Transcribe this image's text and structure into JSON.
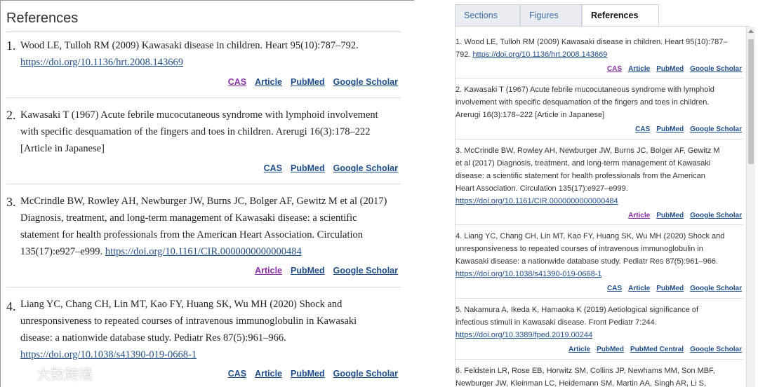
{
  "left": {
    "title": "References",
    "refs": [
      {
        "num": "1.",
        "lines": [
          "Wood LE, Tulloh RM (2009) Kawasaki disease in children. Heart 95(10):787–792."
        ],
        "doi": "https://doi.org/10.1136/hrt.2008.143669",
        "links": [
          {
            "label": "CAS",
            "visited": true
          },
          {
            "label": "Article"
          },
          {
            "label": "PubMed"
          },
          {
            "label": "Google Scholar"
          }
        ]
      },
      {
        "num": "2.",
        "lines": [
          "Kawasaki T (1967) Acute febrile mucocutaneous syndrome with lymphoid involvement",
          "with specific desquamation of the fingers and toes in children. Arerugi 16(3):178–222",
          "[Article in Japanese]"
        ],
        "links": [
          {
            "label": "CAS"
          },
          {
            "label": "PubMed"
          },
          {
            "label": "Google Scholar"
          }
        ]
      },
      {
        "num": "3.",
        "lines": [
          "McCrindle BW, Rowley AH, Newburger JW, Burns JC, Bolger AF, Gewitz M et al (2017)",
          "Diagnosis, treatment, and long-term management of Kawasaki disease: a scientific",
          "statement for health professionals from the American Heart Association. Circulation"
        ],
        "lastline_prefix": "135(17):e927–e999. ",
        "doi": "https://doi.org/10.1161/CIR.0000000000000484",
        "links": [
          {
            "label": "Article",
            "visited": true
          },
          {
            "label": "PubMed"
          },
          {
            "label": "Google Scholar"
          }
        ]
      },
      {
        "num": "4.",
        "lines": [
          "Liang YC, Chang CH, Lin MT, Kao FY, Huang SK, Wu MH (2020) Shock and",
          "unresponsiveness to repeated courses of intravenous immunoglobulin in Kawasaki",
          "disease: a nationwide database study. Pediatr Res 87(5):961–966."
        ],
        "doi": "https://doi.org/10.1038/s41390-019-0668-1",
        "links": [
          {
            "label": "CAS"
          },
          {
            "label": "Article"
          },
          {
            "label": "PubMed"
          },
          {
            "label": "Google Scholar"
          }
        ]
      }
    ]
  },
  "right": {
    "tabs": [
      {
        "label": "Sections"
      },
      {
        "label": "Figures"
      },
      {
        "label": "References",
        "active": true
      }
    ],
    "refs": [
      {
        "lines": [
          "1. Wood LE, Tulloh RM (2009) Kawasaki disease in children. Heart 95(10):787–"
        ],
        "lastline_prefix": "792. ",
        "doi": "https://doi.org/10.1136/hrt.2008.143669",
        "links": [
          {
            "label": "CAS",
            "visited": true
          },
          {
            "label": "Article"
          },
          {
            "label": "PubMed"
          },
          {
            "label": "Google Scholar"
          }
        ]
      },
      {
        "lines": [
          "2. Kawasaki T (1967) Acute febrile mucocutaneous syndrome with lymphoid",
          "involvement with specific desquamation of the fingers and toes in children.",
          "Arerugi 16(3):178–222 [Article in Japanese]"
        ],
        "links": [
          {
            "label": "CAS"
          },
          {
            "label": "PubMed"
          },
          {
            "label": "Google Scholar"
          }
        ]
      },
      {
        "lines": [
          "3. McCrindle BW, Rowley AH, Newburger JW, Burns JC, Bolger AF, Gewitz M",
          "et al (2017) Diagnosis, treatment, and long-term management of Kawasaki",
          "disease: a scientific statement for health professionals from the American",
          "Heart Association. Circulation 135(17):e927–e999."
        ],
        "doi": "https://doi.org/10.1161/CIR.0000000000000484",
        "links": [
          {
            "label": "Article",
            "visited": true
          },
          {
            "label": "PubMed"
          },
          {
            "label": "Google Scholar"
          }
        ]
      },
      {
        "lines": [
          "4. Liang YC, Chang CH, Lin MT, Kao FY, Huang SK, Wu MH (2020) Shock and",
          "unresponsiveness to repeated courses of intravenous immunoglobulin in",
          "Kawasaki disease: a nationwide database study. Pediatr Res 87(5):961–966."
        ],
        "doi": "https://doi.org/10.1038/s41390-019-0668-1",
        "links": [
          {
            "label": "CAS"
          },
          {
            "label": "Article"
          },
          {
            "label": "PubMed"
          },
          {
            "label": "Google Scholar"
          }
        ]
      },
      {
        "lines": [
          "5. Nakamura A, Ikeda K, Hamaoka K (2019) Aetiological significance of",
          "infectious stimuli in Kawasaki disease. Front Pediatr 7:244."
        ],
        "doi": "https://doi.org/10.3389/fped.2019.00244",
        "links": [
          {
            "label": "Article"
          },
          {
            "label": "PubMed"
          },
          {
            "label": "PubMed Central"
          },
          {
            "label": "Google Scholar"
          }
        ]
      },
      {
        "lines": [
          "6. Feldstein LR, Rose EB, Horwitz SM, Collins JP, Newhams MM, Son MBF,",
          "Newburger JW, Kleinman LC, Heidemann SM, Martin AA, Singh AR, Li S,"
        ]
      }
    ]
  },
  "watermark": "大数跨境"
}
